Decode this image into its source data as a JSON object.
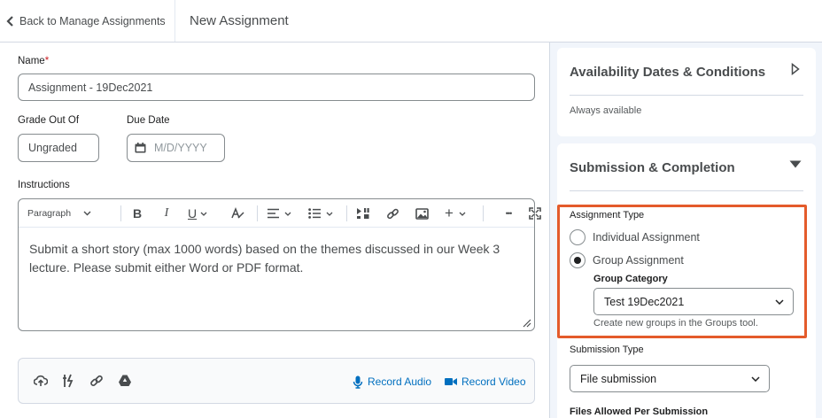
{
  "header": {
    "back_label": "Back to Manage Assignments",
    "title": "New Assignment"
  },
  "form": {
    "name_label": "Name",
    "name_required": "*",
    "name_value": "Assignment - 19Dec2021",
    "grade_label": "Grade Out Of",
    "grade_value": "Ungraded",
    "due_label": "Due Date",
    "due_placeholder": "M/D/YYYY",
    "instructions_label": "Instructions",
    "editor": {
      "paragraph_style": "Paragraph",
      "bold": "B",
      "italic": "I",
      "underline": "U",
      "plus": "+",
      "more": "•••",
      "text": "Submit a short story (max 1000 words) based on the themes discussed in our Week 3 lecture. Please submit either Word or PDF format."
    },
    "attachments": {
      "record_audio": "Record Audio",
      "record_video": "Record Video"
    }
  },
  "panel": {
    "availability": {
      "title": "Availability Dates & Conditions",
      "summary": "Always available"
    },
    "submission": {
      "title": "Submission & Completion",
      "assignment_type_label": "Assignment Type",
      "options": [
        "Individual Assignment",
        "Group Assignment"
      ],
      "selected_index": 1,
      "group_category_label": "Group Category",
      "group_category_value": "Test 19Dec2021",
      "group_help": "Create new groups in the Groups tool.",
      "submission_type_label": "Submission Type",
      "submission_type_value": "File submission",
      "files_allowed_label": "Files Allowed Per Submission"
    }
  },
  "colors": {
    "accent_link": "#006fbf",
    "highlight": "#e45b2b",
    "panel_bg": "#f1f5fb"
  }
}
